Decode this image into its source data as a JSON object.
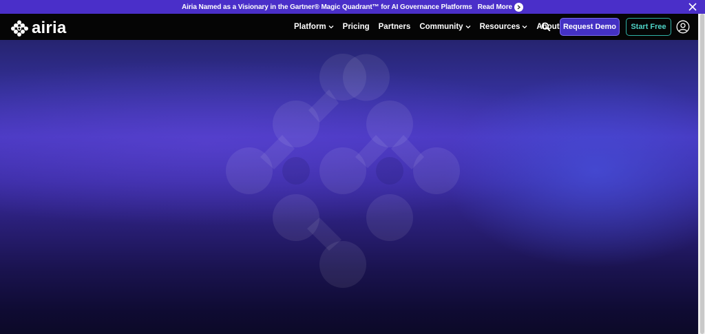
{
  "announcement": {
    "text": "Airia Named as a Visionary in the Gartner® Magic Quadrant™ for AI Governance Platforms",
    "link_label": "Read More",
    "link_icon": "arrow-right-circle-icon",
    "close_icon": "close-icon"
  },
  "header": {
    "logo_text": "airia",
    "logo_icon": "airia-logo-icon",
    "nav": [
      {
        "label": "Platform",
        "has_dropdown": true
      },
      {
        "label": "Pricing",
        "has_dropdown": false
      },
      {
        "label": "Partners",
        "has_dropdown": false
      },
      {
        "label": "Community",
        "has_dropdown": true
      },
      {
        "label": "Resources",
        "has_dropdown": true
      },
      {
        "label": "About",
        "has_dropdown": false
      }
    ],
    "search_icon": "search-icon",
    "request_demo_label": "Request Demo",
    "start_free_label": "Start Free",
    "account_icon": "user-account-icon"
  },
  "hero": {
    "mark_icon": "airia-mark-graphic"
  },
  "colors": {
    "announcement_bg": "#4a2fc9",
    "navbar_bg": "#050505",
    "primary_button": "#4431c4",
    "secondary_button_border": "#2fb3a8",
    "hero_top": "#262470",
    "hero_mid": "#4838c0",
    "hero_bottom": "#0c0a28"
  }
}
